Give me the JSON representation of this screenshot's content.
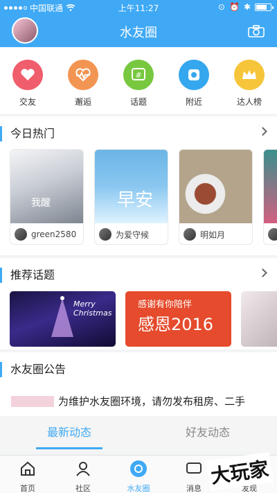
{
  "status": {
    "carrier": "中国联通",
    "time": "上午11:27"
  },
  "header": {
    "title": "水友圈"
  },
  "categories": [
    {
      "label": "交友",
      "color": "#f05d6c",
      "icon": "heart-icon"
    },
    {
      "label": "邂逅",
      "color": "#f39552",
      "icon": "pulse-heart-icon"
    },
    {
      "label": "话题",
      "color": "#78c83f",
      "icon": "hashtag-icon"
    },
    {
      "label": "附近",
      "color": "#35a7ee",
      "icon": "location-icon"
    },
    {
      "label": "达人榜",
      "color": "#f6c53a",
      "icon": "crown-icon"
    }
  ],
  "hot": {
    "title": "今日热门",
    "cards": [
      {
        "user": "green2580",
        "overlay": "我醒"
      },
      {
        "user": "为爱守候",
        "overlay": "早安"
      },
      {
        "user": "明如月",
        "overlay": ""
      }
    ]
  },
  "topics": {
    "title": "推荐话题",
    "cards": [
      {
        "text": "Merry Christmas"
      },
      {
        "text": "感恩2016",
        "subtext": "感谢有你陪伴"
      }
    ]
  },
  "notice": {
    "title": "水友圈公告",
    "text": "为维护水友圈环境，请勿发布租房、二手"
  },
  "tabs": [
    {
      "label": "最新动态",
      "active": true
    },
    {
      "label": "好友动态",
      "active": false
    }
  ],
  "bottom_nav": [
    {
      "label": "首页",
      "icon": "home-icon"
    },
    {
      "label": "社区",
      "icon": "community-icon"
    },
    {
      "label": "水友圈",
      "icon": "circle-icon",
      "active": true
    },
    {
      "label": "消息",
      "icon": "message-icon"
    },
    {
      "label": "发现",
      "icon": "discover-icon"
    }
  ],
  "watermark": "大玩家"
}
